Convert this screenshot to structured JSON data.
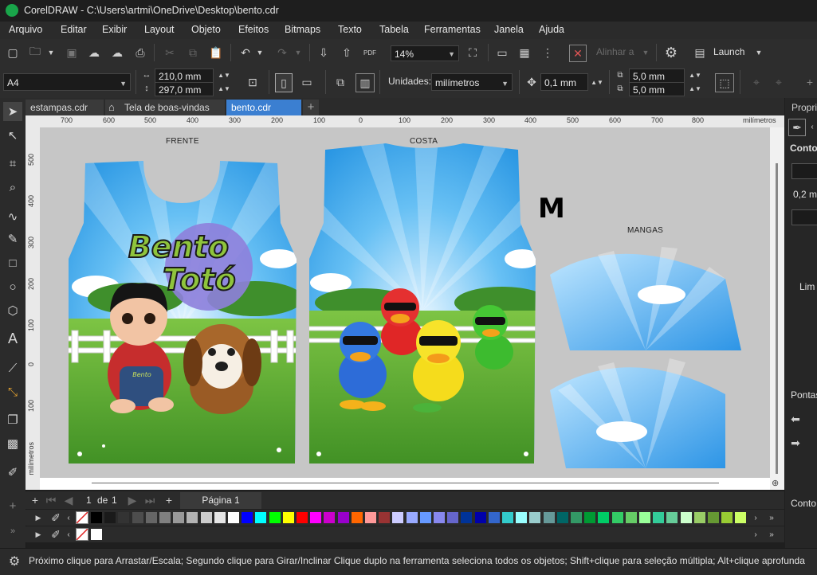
{
  "title": "CorelDRAW - C:\\Users\\artmi\\OneDrive\\Desktop\\bento.cdr",
  "menu": [
    "Arquivo",
    "Editar",
    "Exibir",
    "Layout",
    "Objeto",
    "Efeitos",
    "Bitmaps",
    "Texto",
    "Tabela",
    "Ferramentas",
    "Janela",
    "Ajuda"
  ],
  "toolbar": {
    "zoom": "14%",
    "align_label": "Alinhar a",
    "launch_label": "Launch"
  },
  "propbar": {
    "page_size": "A4",
    "width": "210,0 mm",
    "height": "297,0 mm",
    "units_label": "Unidades:",
    "units_value": "milímetros",
    "nudge": "0,1 mm",
    "dup_x": "5,0 mm",
    "dup_y": "5,0 mm"
  },
  "tabs": [
    "estampas.cdr",
    "Tela de boas-vindas",
    "bento.cdr"
  ],
  "ruler": {
    "h_ticks": [
      "700",
      "600",
      "500",
      "400",
      "300",
      "200",
      "100",
      "0",
      "100",
      "200",
      "300",
      "400",
      "500",
      "600",
      "700",
      "800"
    ],
    "h_unit": "milímetros",
    "v_ticks": [
      "500",
      "400",
      "300",
      "200",
      "100",
      "0",
      "100"
    ],
    "v_unit": "milímetros"
  },
  "artwork": {
    "front_label": "FRENTE",
    "back_label": "COSTA",
    "sleeves_label": "MANGAS",
    "size": "M",
    "logo_line1": "Bento",
    "logo_line2": "Totó",
    "shirt_text": "Bento"
  },
  "pager": {
    "current": "1",
    "of": "de",
    "total": "1",
    "page_tab": "Página 1"
  },
  "palette": [
    "#000000",
    "#1a1a1a",
    "#333333",
    "#4d4d4d",
    "#666666",
    "#808080",
    "#999999",
    "#b3b3b3",
    "#cccccc",
    "#e6e6e6",
    "#ffffff",
    "#0000ff",
    "#00ffff",
    "#00ff00",
    "#ffff00",
    "#ff0000",
    "#ff00ff",
    "#cc00cc",
    "#9900cc",
    "#ff6600",
    "#ff9999",
    "#993333",
    "#ccccff",
    "#99aaff",
    "#6699ff",
    "#8888ee",
    "#6666cc",
    "#003399",
    "#0000aa",
    "#3366cc",
    "#33cccc",
    "#99ffff",
    "#99cccc",
    "#669999",
    "#006666",
    "#339966",
    "#009933",
    "#00cc66",
    "#33cc66",
    "#66cc66",
    "#99ff99",
    "#33cc99",
    "#66cc99",
    "#ccffcc",
    "#99cc66",
    "#669933",
    "#99cc33",
    "#ccff66"
  ],
  "right_panel": {
    "title": "Propri",
    "contour": "Conto",
    "value": "0,2 m",
    "lim": "Lim",
    "points": "Pontas",
    "contour2": "Conto"
  },
  "status": "Próximo clique para Arrastar/Escala; Segundo clique para Girar/Inclinar Clique duplo na ferramenta seleciona todos os objetos; Shift+clique para seleção múltipla; Alt+clique aprofunda"
}
